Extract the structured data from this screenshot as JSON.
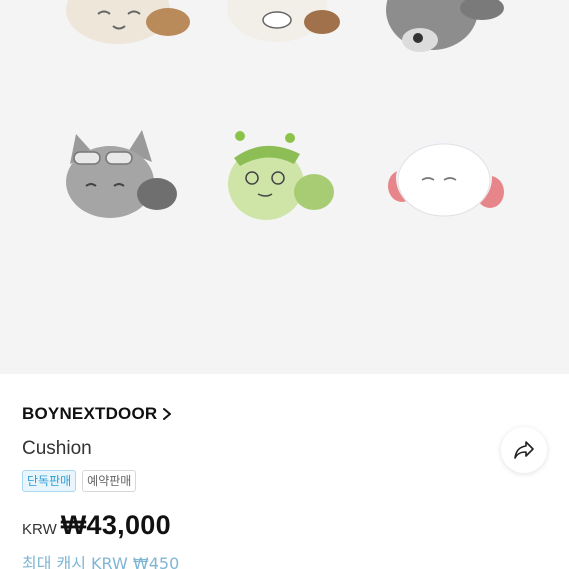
{
  "product": {
    "artist": "BOYNEXTDOOR",
    "name": "Cushion",
    "badges": [
      "단독판매",
      "예약판매"
    ],
    "currency": "KRW",
    "price": "₩43,000",
    "cash_label": "최대 캐시 KRW ₩450"
  },
  "gallery": {
    "items": [
      {
        "icon": "cat-plush-cream"
      },
      {
        "icon": "cat-plush-brown"
      },
      {
        "icon": "bear-plush-gray"
      },
      {
        "icon": "cat-plush-gray-sunglasses"
      },
      {
        "icon": "frog-plush-green"
      },
      {
        "icon": "ghost-plush-white"
      }
    ]
  },
  "colors": {
    "badge_blue": "#2f9fd6",
    "cash_blue": "#7fb6d4"
  }
}
